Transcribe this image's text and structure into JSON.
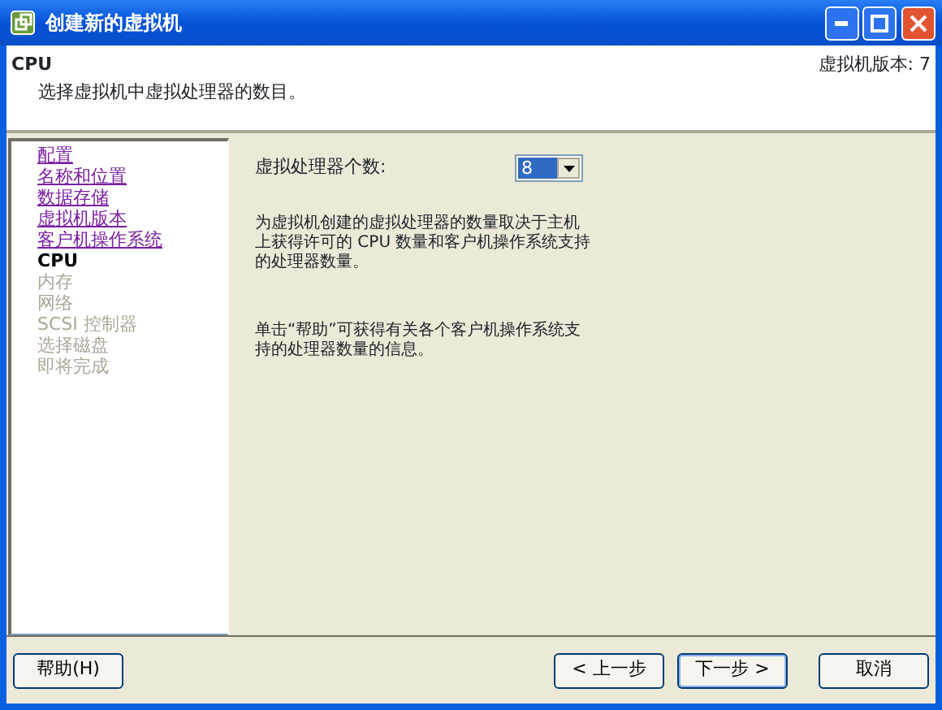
{
  "window": {
    "title": "创建新的虚拟机"
  },
  "header": {
    "title": "CPU",
    "subtitle": "选择虚拟机中虚拟处理器的数目。",
    "version": "虚拟机版本: 7"
  },
  "steps": [
    {
      "label": "配置",
      "kind": "done"
    },
    {
      "label": "名称和位置",
      "kind": "done"
    },
    {
      "label": "数据存储",
      "kind": "done"
    },
    {
      "label": "虚拟机版本",
      "kind": "done"
    },
    {
      "label": "客户机操作系统",
      "kind": "done"
    },
    {
      "label": "CPU",
      "kind": "current"
    },
    {
      "label": "内存",
      "kind": "pending"
    },
    {
      "label": "网络",
      "kind": "pending"
    },
    {
      "label": "SCSI 控制器",
      "kind": "pending"
    },
    {
      "label": "选择磁盘",
      "kind": "pending"
    },
    {
      "label": "即将完成",
      "kind": "pending"
    }
  ],
  "cpu_count": {
    "label": "虚拟处理器个数:",
    "value": "8"
  },
  "paragraphs": [
    "为虚拟机创建的虚拟处理器的数量取决于主机上获得许可的 CPU 数量和客户机操作系统支持的处理器数量。",
    "单击“帮助”可获得有关各个客户机操作系统支持的处理器数量的信息。"
  ],
  "buttons": {
    "help": "帮助(H)",
    "back": "< 上一步",
    "next": "下一步 >",
    "cancel": "取消"
  }
}
